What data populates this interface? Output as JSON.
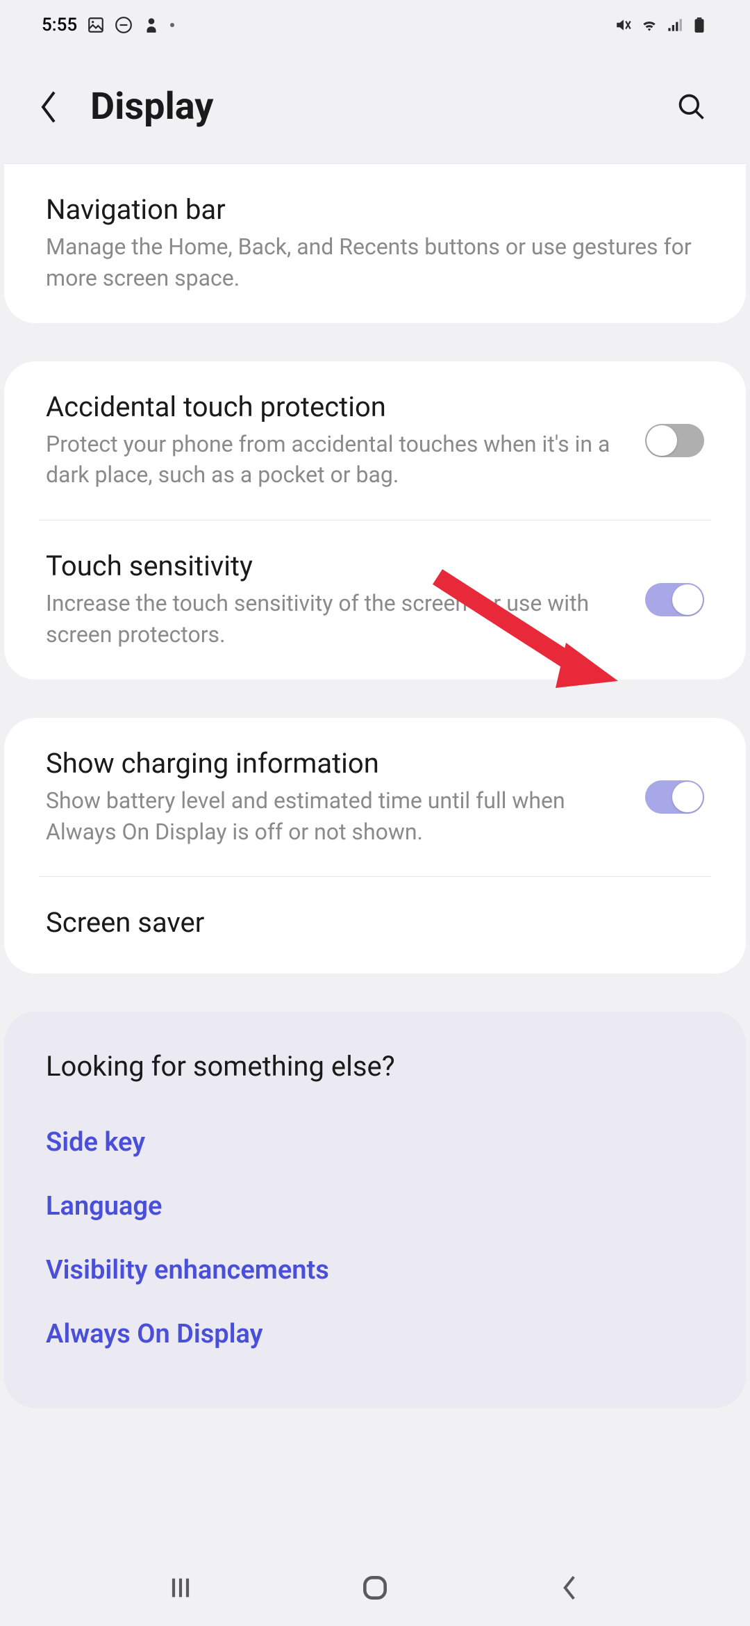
{
  "status_bar": {
    "time": "5:55"
  },
  "header": {
    "title": "Display"
  },
  "card1": {
    "item1": {
      "title": "Navigation bar",
      "desc": "Manage the Home, Back, and Recents buttons or use gestures for more screen space."
    }
  },
  "card2": {
    "item1": {
      "title": "Accidental touch protection",
      "desc": "Protect your phone from accidental touches when it's in a dark place, such as a pocket or bag."
    },
    "item2": {
      "title": "Touch sensitivity",
      "desc": "Increase the touch sensitivity of the screen for use with screen protectors."
    }
  },
  "card3": {
    "item1": {
      "title": "Show charging information",
      "desc": "Show battery level and estimated time until full when Always On Display is off or not shown."
    },
    "item2": {
      "title": "Screen saver"
    }
  },
  "looking": {
    "title": "Looking for something else?",
    "links": [
      "Side key",
      "Language",
      "Visibility enhancements",
      "Always On Display"
    ]
  }
}
